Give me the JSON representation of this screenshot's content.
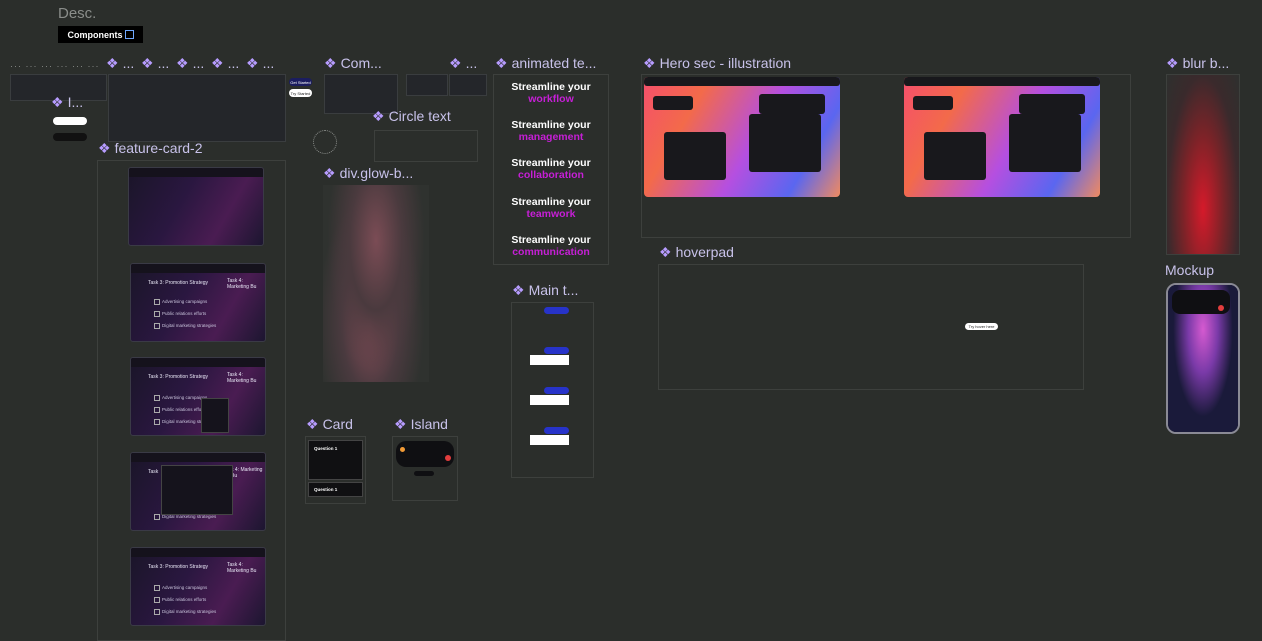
{
  "canvas": {
    "desc_label": "Desc.",
    "components_badge": "Components"
  },
  "frames": {
    "small_i": "I...",
    "feature_card": "feature-card-2",
    "com": "Com...",
    "circle_text": "Circle text",
    "glow": "div.glow-b...",
    "animated": "animated te...",
    "main_t": "Main t...",
    "card": "Card",
    "island": "Island",
    "hero": "Hero sec - illustration",
    "hoverpad": "hoverpad",
    "blur": "blur b...",
    "mockup": "Mockup",
    "ellipsis_frames": [
      "...",
      "...",
      "...",
      "...",
      "..."
    ]
  },
  "animated_text": [
    {
      "prefix": "Streamline your",
      "word": "workflow"
    },
    {
      "prefix": "Streamline your",
      "word": "management"
    },
    {
      "prefix": "Streamline your",
      "word": "collaboration"
    },
    {
      "prefix": "Streamline your",
      "word": "teamwork"
    },
    {
      "prefix": "Streamline your",
      "word": "communication"
    }
  ],
  "feature_cards": {
    "task_title": "Task 3: Promotion Strategy",
    "task_title_2": "Task 4: Marketing Bu",
    "items": [
      "Advertising campaigns",
      "Public relations efforts",
      "Digital marketing strategies"
    ]
  },
  "card": {
    "question_1": "Question 1",
    "question_2": "Question 1"
  },
  "buttons": {
    "get_started": "Get Started",
    "try_started": "Try Started"
  },
  "hoverpad_btn": "Try hover here",
  "colors": {
    "bg": "#2b2e2b",
    "accent_purple": "#c61fd6",
    "frame_title": "#c8c2ea",
    "diamond": "#b79cff"
  }
}
